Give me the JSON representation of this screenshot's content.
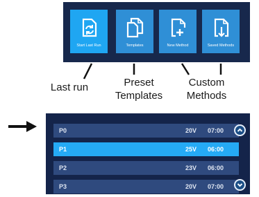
{
  "toolbar": {
    "buttons": [
      {
        "label": "Start Last Run",
        "icon": "restart-document-icon"
      },
      {
        "label": "Templates",
        "icon": "copy-documents-icon"
      },
      {
        "label": "New Method",
        "icon": "new-document-icon"
      },
      {
        "label": "Saved Methods",
        "icon": "download-document-icon"
      }
    ]
  },
  "captions": {
    "last_run": "Last run",
    "preset_templates": [
      "Preset",
      "Templates"
    ],
    "custom_methods": [
      "Custom",
      "Methods"
    ]
  },
  "method_list": {
    "rows": [
      {
        "name": "P0",
        "voltage": "20V",
        "time": "07:00",
        "selected": false
      },
      {
        "name": "P1",
        "voltage": "25V",
        "time": "06:00",
        "selected": true
      },
      {
        "name": "P2",
        "voltage": "23V",
        "time": "06:00",
        "selected": false
      },
      {
        "name": "P3",
        "voltage": "20V",
        "time": "07:00",
        "selected": false
      }
    ],
    "scroll_up_icon": "chevron-up-icon",
    "scroll_down_icon": "chevron-down-icon"
  },
  "colors": {
    "panel": "#17284c",
    "button": "#2f8fd6",
    "row": "#2f4a7e",
    "row_selected": "#25aaf5"
  }
}
